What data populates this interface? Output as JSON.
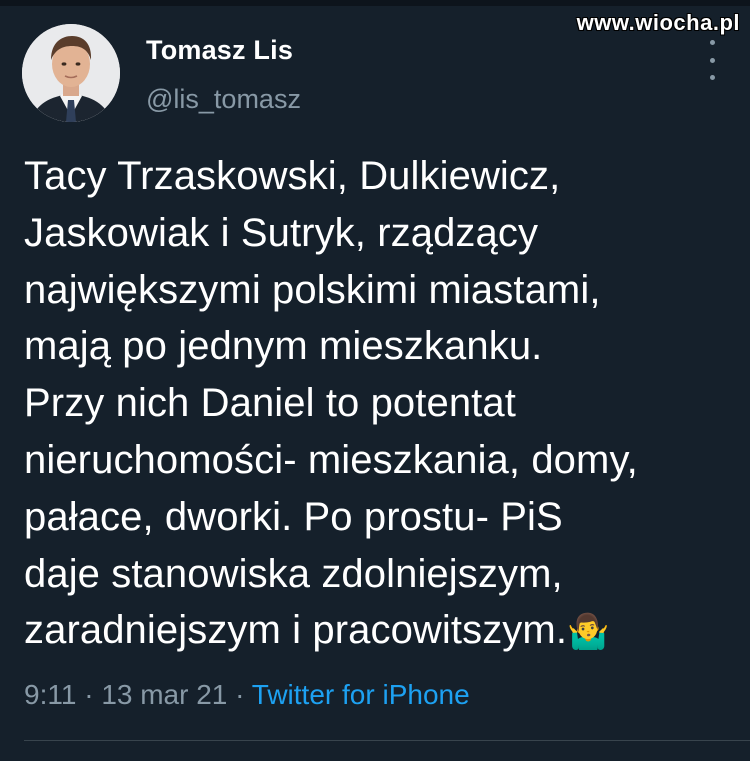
{
  "watermark": "www.wiocha.pl",
  "author": {
    "display_name": "Tomasz Lis",
    "handle": "@lis_tomasz",
    "avatar_icon": "profile-photo"
  },
  "tweet": {
    "text": "Tacy Trzaskowski,  Dulkiewicz,\nJaskowiak i Sutryk, rządzący\nnajwiększymi polskimi  miastami,\nmają  po jednym mieszkanku.\nPrzy nich Daniel to potentat\nnieruchomości- mieszkania, domy,\npałace, dworki. Po prostu- PiS\ndaje stanowiska zdolniejszym,\nzaradniejszym  i pracowitszym.",
    "emoji": "🤷‍♂️",
    "emoji_icon": "man-shrugging-emoji"
  },
  "meta": {
    "time": "9:11",
    "separator": " · ",
    "date": "13 mar 21",
    "source": "Twitter for iPhone"
  },
  "colors": {
    "background": "#15202b",
    "text": "#ffffff",
    "muted": "#8899a6",
    "link": "#1da1f2",
    "divider": "#38444d"
  },
  "icons": {
    "more": "more-vertical-icon"
  }
}
